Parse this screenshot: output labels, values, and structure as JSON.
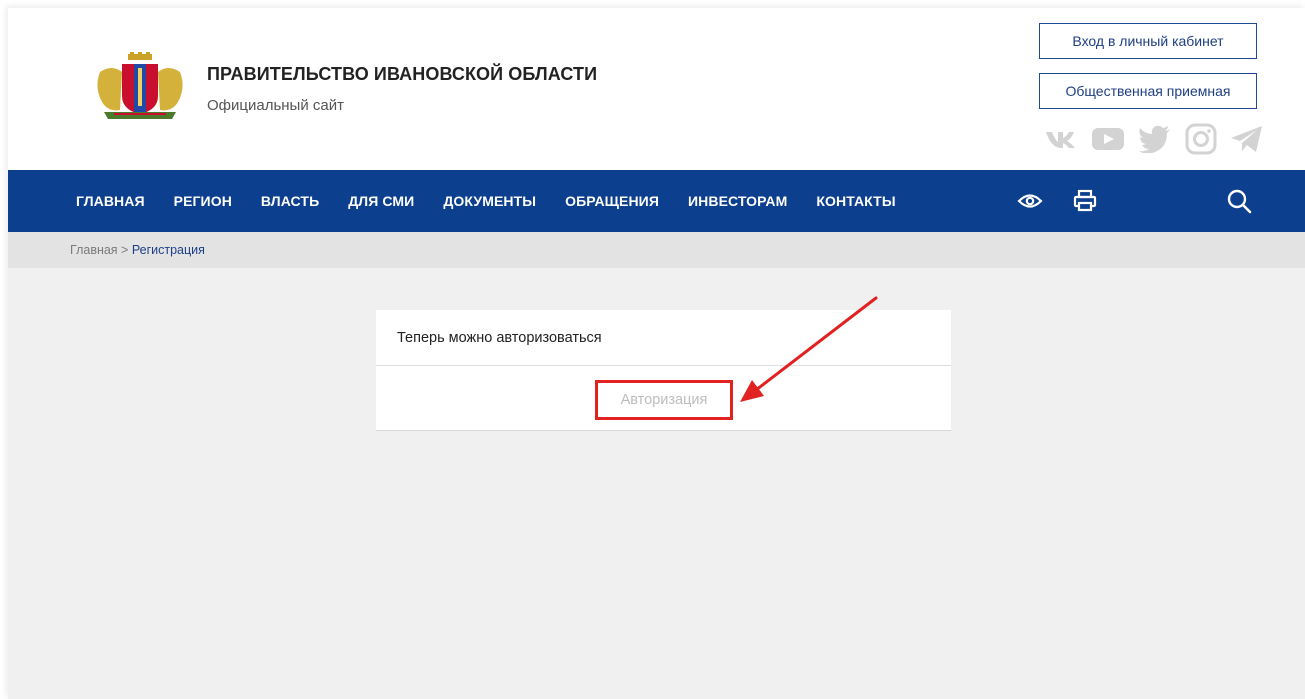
{
  "header": {
    "title": "ПРАВИТЕЛЬСТВО ИВАНОВСКОЙ ОБЛАСТИ",
    "subtitle": "Официальный сайт",
    "login_label": "Вход в личный кабинет",
    "reception_label": "Общественная приемная",
    "social_icons": [
      "vk-icon",
      "youtube-icon",
      "twitter-icon",
      "instagram-icon",
      "telegram-icon"
    ]
  },
  "nav": {
    "items": [
      "ГЛАВНАЯ",
      "РЕГИОН",
      "ВЛАСТЬ",
      "ДЛЯ СМИ",
      "ДОКУМЕНТЫ",
      "ОБРАЩЕНИЯ",
      "ИНВЕСТОРАМ",
      "КОНТАКТЫ"
    ],
    "icons": [
      "eye-icon",
      "print-icon",
      "search-icon"
    ]
  },
  "breadcrumb": {
    "home": "Главная",
    "separator": " > ",
    "current": "Регистрация"
  },
  "card": {
    "message": "Теперь можно авторизоваться",
    "button_label": "Авторизация"
  },
  "colors": {
    "nav_bg": "#0d3f8f",
    "accent_blue": "#1e3f85",
    "highlight_red": "#e22121",
    "page_bg": "#f0f0f0",
    "social_gray": "#d3d3d3"
  }
}
